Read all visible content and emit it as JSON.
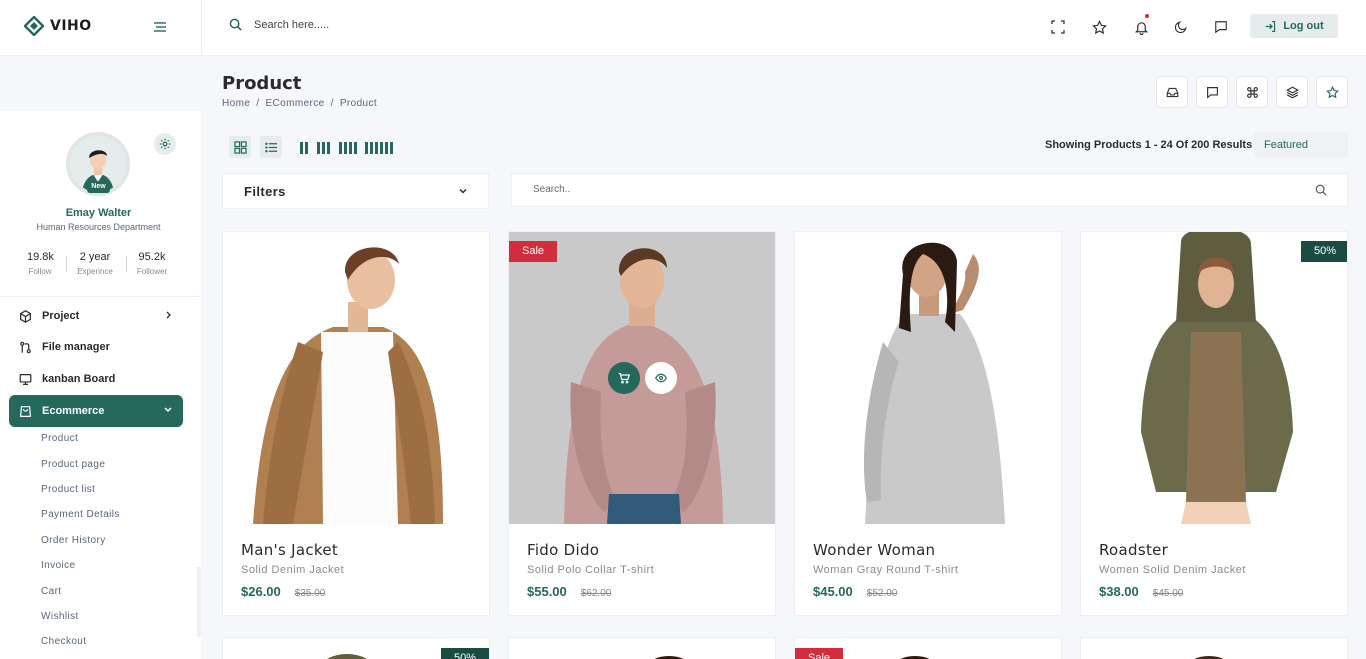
{
  "header": {
    "logo_text": "VIHO",
    "search_placeholder": "Search here.....",
    "logout_label": "Log out"
  },
  "profile": {
    "badge": "New",
    "name": "Emay Walter",
    "department": "Human Resources Department",
    "stats": [
      {
        "value": "19.8k",
        "label": "Follow"
      },
      {
        "value": "2 year",
        "label": "Experince"
      },
      {
        "value": "95.2k",
        "label": "Follower"
      }
    ]
  },
  "nav": {
    "items": [
      {
        "label": "Project",
        "icon": "box-icon"
      },
      {
        "label": "File manager",
        "icon": "git-pull-request-icon"
      },
      {
        "label": "kanban Board",
        "icon": "monitor-icon"
      },
      {
        "label": "Ecommerce",
        "icon": "shopping-bag-icon"
      }
    ],
    "sub_items": [
      "Product",
      "Product page",
      "Product list",
      "Payment Details",
      "Order History",
      "Invoice",
      "Cart",
      "Wishlist",
      "Checkout"
    ]
  },
  "page": {
    "title": "Product",
    "breadcrumb": [
      "Home",
      "ECommerce",
      "Product"
    ],
    "breadcrumb_sep": "/",
    "showing_text": "Showing Products 1 - 24 Of 200 Results",
    "sort_value": "Featured",
    "filters_label": "Filters",
    "product_search_placeholder": "Search.."
  },
  "products": [
    {
      "name": "Man's Jacket",
      "desc": "Solid Denim Jacket",
      "price": "$26.00",
      "old_price": "$35.00",
      "ribbon": ""
    },
    {
      "name": "Fido Dido",
      "desc": "Solid Polo Collar T-shirt",
      "price": "$55.00",
      "old_price": "$62.00",
      "ribbon": "Sale"
    },
    {
      "name": "Wonder Woman",
      "desc": "Woman Gray Round T-shirt",
      "price": "$45.00",
      "old_price": "$52.00",
      "ribbon": ""
    },
    {
      "name": "Roadster",
      "desc": "Women Solid Denim Jacket",
      "price": "$38.00",
      "old_price": "$45.00",
      "ribbon": "50%"
    }
  ],
  "second_row_ribbons": [
    "50%",
    "",
    "Sale",
    ""
  ],
  "colors": {
    "primary": "#24695c",
    "sale": "#d22d3d",
    "ribbon_dark": "#1b4c43"
  }
}
